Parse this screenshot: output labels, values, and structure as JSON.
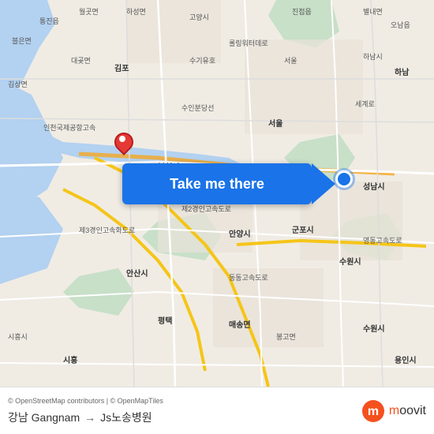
{
  "map": {
    "attribution": "© OpenStreetMap contributors | © OpenMapTiles",
    "background_color": "#e8e0d8"
  },
  "button": {
    "label": "Take me there"
  },
  "footer": {
    "copyright": "© OpenStreetMap contributors | © OpenMapTiles",
    "origin": "강남 Gangnam",
    "destination": "Js노송병원",
    "arrow": "→",
    "logo": "moovit"
  },
  "pin": {
    "color": "#e53935",
    "lat_label": "origin"
  },
  "dot": {
    "color": "#1a73e8",
    "lat_label": "destination"
  }
}
